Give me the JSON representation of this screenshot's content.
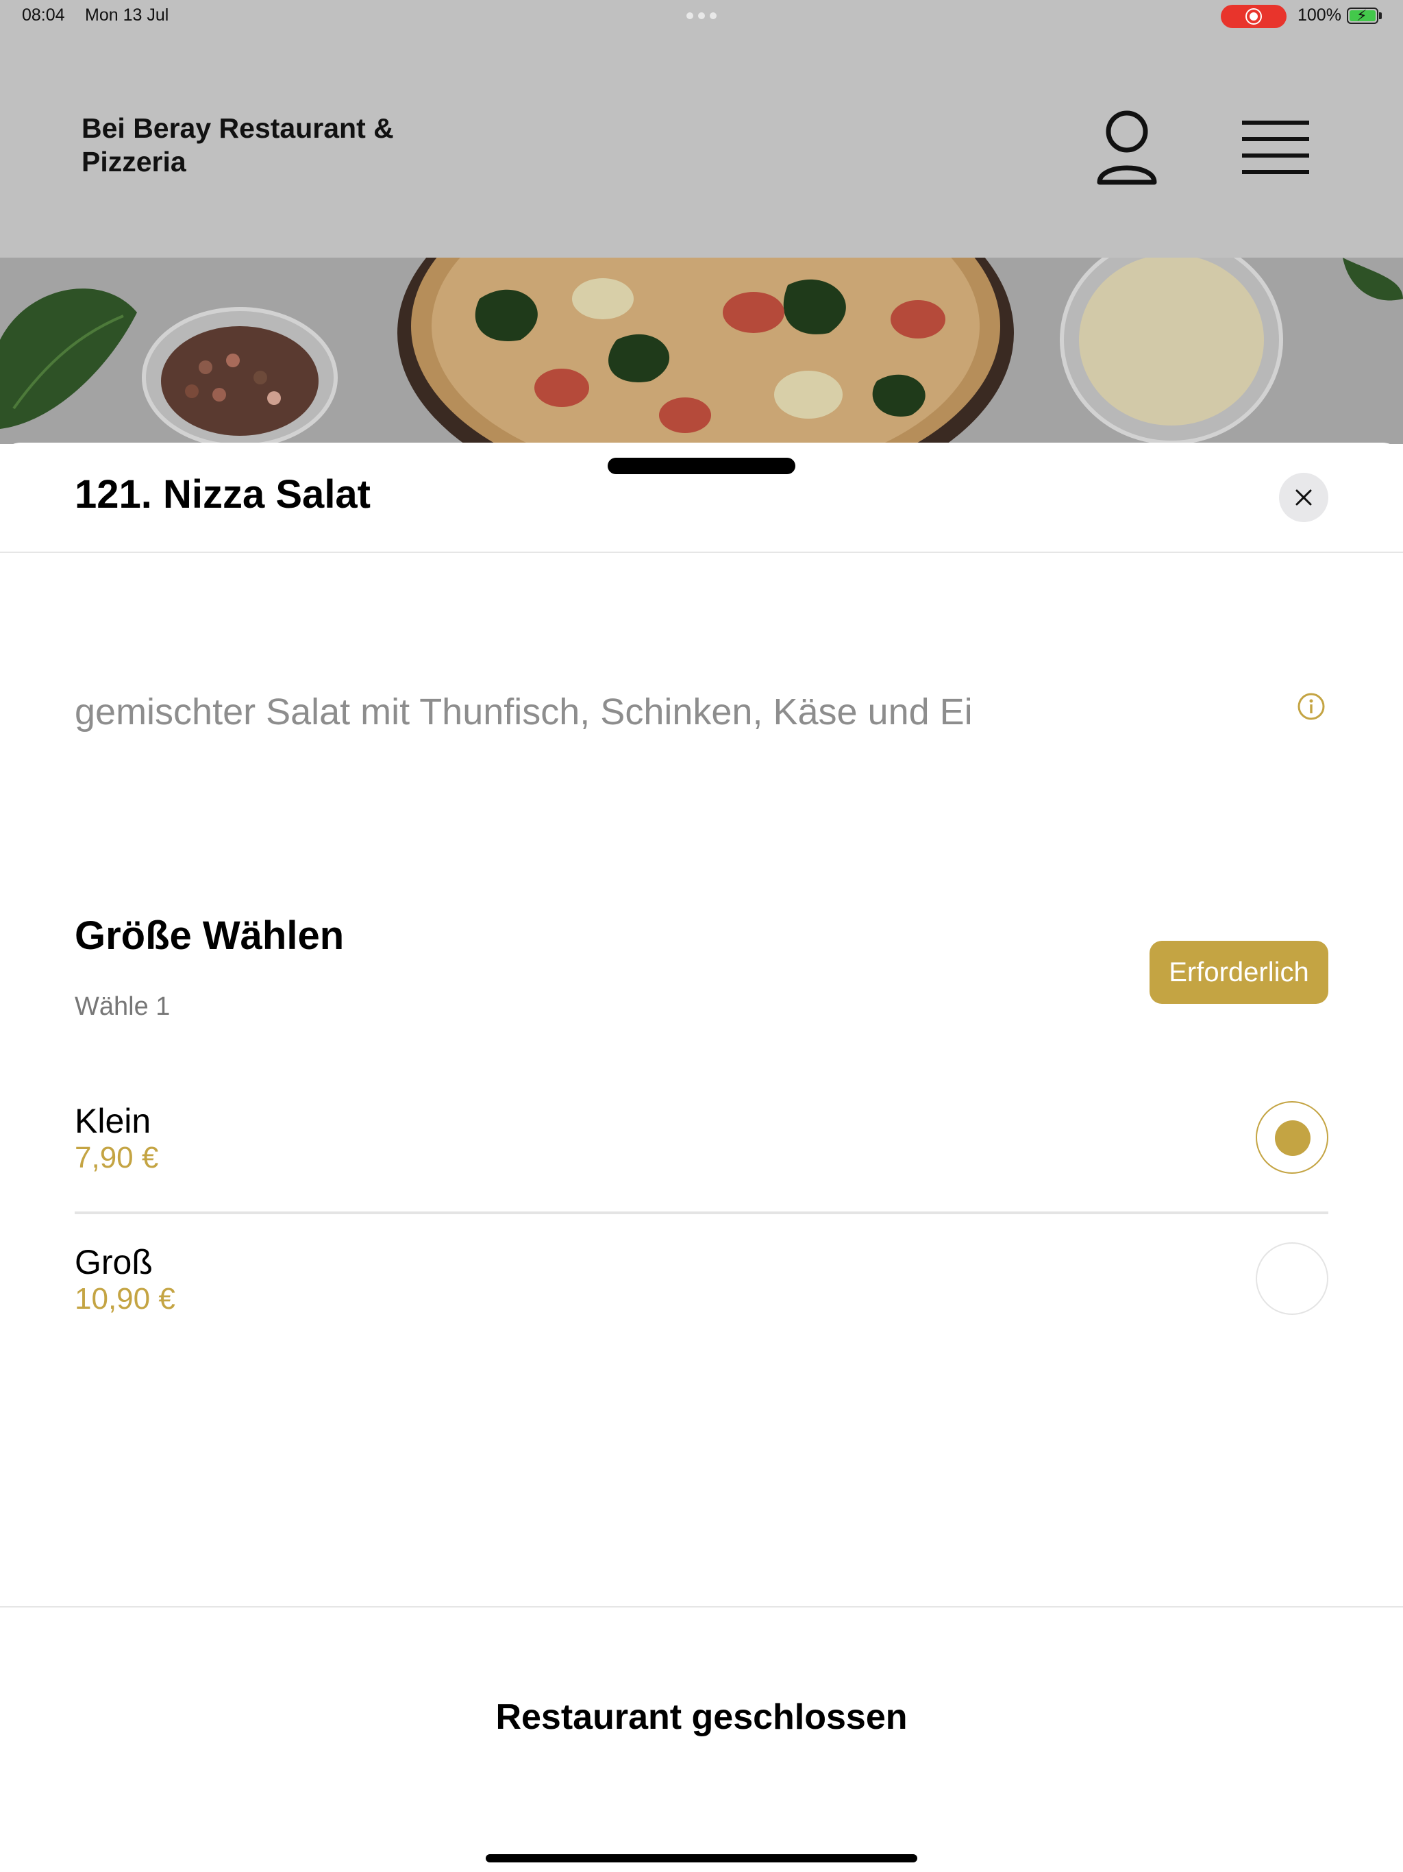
{
  "status_bar": {
    "time": "08:04",
    "date": "Mon 13 Jul",
    "battery_percent": "100%",
    "recording_color": "#e8342c"
  },
  "header": {
    "brand_name": "Bei Beray Restaurant & Pizzeria",
    "profile_icon": "person-icon",
    "menu_icon": "hamburger-menu-icon"
  },
  "hero": {
    "image_description_icon": "pizza-hero-image"
  },
  "sheet": {
    "title": "121. Nizza Salat",
    "close_icon": "close-icon",
    "description": "gemischter Salat mit Thunfisch, Schinken, Käse und Ei",
    "info_icon": "info-icon",
    "size_section": {
      "title": "Größe Wählen",
      "subtitle": "Wähle 1",
      "required_label": "Erforderlich",
      "options": [
        {
          "name": "Klein",
          "price": "7,90 €",
          "selected": true
        },
        {
          "name": "Groß",
          "price": "10,90 €",
          "selected": false
        }
      ]
    },
    "footer_label": "Restaurant geschlossen"
  },
  "colors": {
    "accent": "#c4a443",
    "overlay_gray": "#c0c0c0"
  }
}
